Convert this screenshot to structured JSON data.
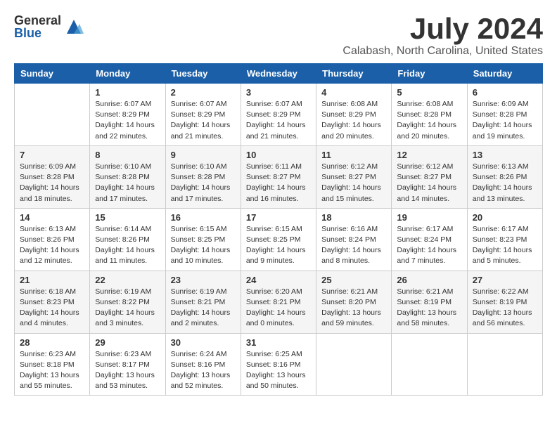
{
  "logo": {
    "general": "General",
    "blue": "Blue"
  },
  "title": "July 2024",
  "location": "Calabash, North Carolina, United States",
  "days_of_week": [
    "Sunday",
    "Monday",
    "Tuesday",
    "Wednesday",
    "Thursday",
    "Friday",
    "Saturday"
  ],
  "weeks": [
    [
      {
        "day": "",
        "info": ""
      },
      {
        "day": "1",
        "info": "Sunrise: 6:07 AM\nSunset: 8:29 PM\nDaylight: 14 hours\nand 22 minutes."
      },
      {
        "day": "2",
        "info": "Sunrise: 6:07 AM\nSunset: 8:29 PM\nDaylight: 14 hours\nand 21 minutes."
      },
      {
        "day": "3",
        "info": "Sunrise: 6:07 AM\nSunset: 8:29 PM\nDaylight: 14 hours\nand 21 minutes."
      },
      {
        "day": "4",
        "info": "Sunrise: 6:08 AM\nSunset: 8:29 PM\nDaylight: 14 hours\nand 20 minutes."
      },
      {
        "day": "5",
        "info": "Sunrise: 6:08 AM\nSunset: 8:28 PM\nDaylight: 14 hours\nand 20 minutes."
      },
      {
        "day": "6",
        "info": "Sunrise: 6:09 AM\nSunset: 8:28 PM\nDaylight: 14 hours\nand 19 minutes."
      }
    ],
    [
      {
        "day": "7",
        "info": "Sunrise: 6:09 AM\nSunset: 8:28 PM\nDaylight: 14 hours\nand 18 minutes."
      },
      {
        "day": "8",
        "info": "Sunrise: 6:10 AM\nSunset: 8:28 PM\nDaylight: 14 hours\nand 17 minutes."
      },
      {
        "day": "9",
        "info": "Sunrise: 6:10 AM\nSunset: 8:28 PM\nDaylight: 14 hours\nand 17 minutes."
      },
      {
        "day": "10",
        "info": "Sunrise: 6:11 AM\nSunset: 8:27 PM\nDaylight: 14 hours\nand 16 minutes."
      },
      {
        "day": "11",
        "info": "Sunrise: 6:12 AM\nSunset: 8:27 PM\nDaylight: 14 hours\nand 15 minutes."
      },
      {
        "day": "12",
        "info": "Sunrise: 6:12 AM\nSunset: 8:27 PM\nDaylight: 14 hours\nand 14 minutes."
      },
      {
        "day": "13",
        "info": "Sunrise: 6:13 AM\nSunset: 8:26 PM\nDaylight: 14 hours\nand 13 minutes."
      }
    ],
    [
      {
        "day": "14",
        "info": "Sunrise: 6:13 AM\nSunset: 8:26 PM\nDaylight: 14 hours\nand 12 minutes."
      },
      {
        "day": "15",
        "info": "Sunrise: 6:14 AM\nSunset: 8:26 PM\nDaylight: 14 hours\nand 11 minutes."
      },
      {
        "day": "16",
        "info": "Sunrise: 6:15 AM\nSunset: 8:25 PM\nDaylight: 14 hours\nand 10 minutes."
      },
      {
        "day": "17",
        "info": "Sunrise: 6:15 AM\nSunset: 8:25 PM\nDaylight: 14 hours\nand 9 minutes."
      },
      {
        "day": "18",
        "info": "Sunrise: 6:16 AM\nSunset: 8:24 PM\nDaylight: 14 hours\nand 8 minutes."
      },
      {
        "day": "19",
        "info": "Sunrise: 6:17 AM\nSunset: 8:24 PM\nDaylight: 14 hours\nand 7 minutes."
      },
      {
        "day": "20",
        "info": "Sunrise: 6:17 AM\nSunset: 8:23 PM\nDaylight: 14 hours\nand 5 minutes."
      }
    ],
    [
      {
        "day": "21",
        "info": "Sunrise: 6:18 AM\nSunset: 8:23 PM\nDaylight: 14 hours\nand 4 minutes."
      },
      {
        "day": "22",
        "info": "Sunrise: 6:19 AM\nSunset: 8:22 PM\nDaylight: 14 hours\nand 3 minutes."
      },
      {
        "day": "23",
        "info": "Sunrise: 6:19 AM\nSunset: 8:21 PM\nDaylight: 14 hours\nand 2 minutes."
      },
      {
        "day": "24",
        "info": "Sunrise: 6:20 AM\nSunset: 8:21 PM\nDaylight: 14 hours\nand 0 minutes."
      },
      {
        "day": "25",
        "info": "Sunrise: 6:21 AM\nSunset: 8:20 PM\nDaylight: 13 hours\nand 59 minutes."
      },
      {
        "day": "26",
        "info": "Sunrise: 6:21 AM\nSunset: 8:19 PM\nDaylight: 13 hours\nand 58 minutes."
      },
      {
        "day": "27",
        "info": "Sunrise: 6:22 AM\nSunset: 8:19 PM\nDaylight: 13 hours\nand 56 minutes."
      }
    ],
    [
      {
        "day": "28",
        "info": "Sunrise: 6:23 AM\nSunset: 8:18 PM\nDaylight: 13 hours\nand 55 minutes."
      },
      {
        "day": "29",
        "info": "Sunrise: 6:23 AM\nSunset: 8:17 PM\nDaylight: 13 hours\nand 53 minutes."
      },
      {
        "day": "30",
        "info": "Sunrise: 6:24 AM\nSunset: 8:16 PM\nDaylight: 13 hours\nand 52 minutes."
      },
      {
        "day": "31",
        "info": "Sunrise: 6:25 AM\nSunset: 8:16 PM\nDaylight: 13 hours\nand 50 minutes."
      },
      {
        "day": "",
        "info": ""
      },
      {
        "day": "",
        "info": ""
      },
      {
        "day": "",
        "info": ""
      }
    ]
  ]
}
